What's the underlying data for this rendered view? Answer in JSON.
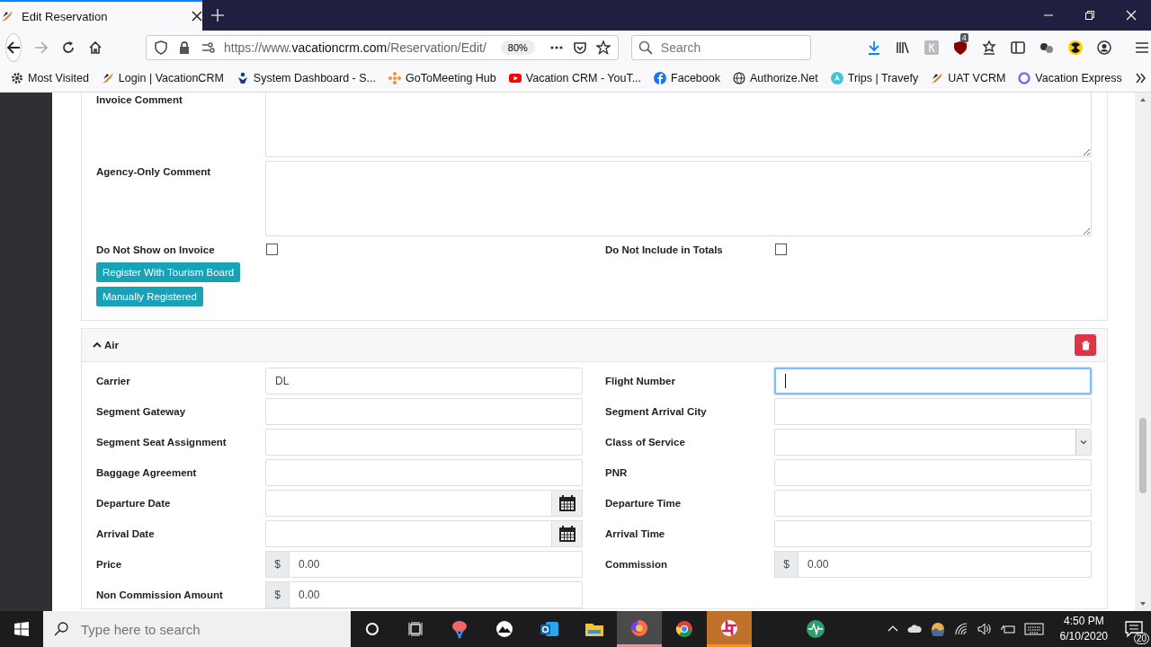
{
  "browser": {
    "tab": {
      "title": "Edit Reservation",
      "selected": true
    },
    "address": {
      "scheme": "https://www.",
      "domain": "vacationcrm.com",
      "path": "/Reservation/Edit/"
    },
    "zoom": "80%",
    "search": {
      "placeholder": "Search"
    },
    "extension_badge": "4",
    "bookmarks": [
      {
        "label": "Most Visited"
      },
      {
        "label": "Login | VacationCRM"
      },
      {
        "label": "System Dashboard - S..."
      },
      {
        "label": "GoToMeeting Hub"
      },
      {
        "label": "Vacation CRM - YouT..."
      },
      {
        "label": "Facebook"
      },
      {
        "label": "Authorize.Net"
      },
      {
        "label": "Trips | Travefy"
      },
      {
        "label": "UAT VCRM"
      },
      {
        "label": "Vacation Express"
      }
    ]
  },
  "page": {
    "comments": [
      {
        "label": "Invoice Comment"
      },
      {
        "label": "Agency-Only Comment"
      }
    ],
    "checkboxes": [
      {
        "label": "Do Not Show on Invoice",
        "checked": false
      },
      {
        "label": "Do Not Include in Totals",
        "checked": false
      }
    ],
    "buttons": [
      "Register With Tourism Board",
      "Manually Registered"
    ],
    "section": {
      "title": "Air",
      "expanded": true
    },
    "fields": [
      {
        "label": "Carrier",
        "kind": "text",
        "value": "DL",
        "focused": false
      },
      {
        "label": "Flight Number",
        "kind": "text",
        "focused": true
      },
      {
        "label": "Segment Gateway",
        "kind": "text",
        "focused": false
      },
      {
        "label": "Segment Arrival City",
        "kind": "text",
        "focused": false
      },
      {
        "label": "Segment Seat Assignment",
        "kind": "text",
        "focused": false
      },
      {
        "label": "Class of Service",
        "kind": "select",
        "focused": false
      },
      {
        "label": "Baggage Agreement",
        "kind": "text",
        "focused": false
      },
      {
        "label": "PNR",
        "kind": "text",
        "focused": false
      },
      {
        "label": "Departure Date",
        "kind": "date",
        "focused": false
      },
      {
        "label": "Departure Time",
        "kind": "text",
        "focused": false
      },
      {
        "label": "Arrival Date",
        "kind": "date",
        "focused": false
      },
      {
        "label": "Arrival Time",
        "kind": "text",
        "focused": false
      },
      {
        "label": "Price",
        "kind": "money",
        "currency": "$",
        "value": "0.00",
        "focused": false
      },
      {
        "label": "Commission",
        "kind": "money",
        "currency": "$",
        "value": "0.00",
        "focused": false
      },
      {
        "label": "Non Commission Amount",
        "kind": "money",
        "currency": "$",
        "value": "0.00",
        "focused": false
      }
    ]
  },
  "taskbar": {
    "search": {
      "placeholder": "Type here to search"
    },
    "apps": [
      {
        "selected": false,
        "flashing": false
      },
      {
        "selected": false,
        "flashing": false
      },
      {
        "selected": false,
        "flashing": false
      },
      {
        "selected": false,
        "flashing": false
      },
      {
        "selected": true,
        "flashing": false
      },
      {
        "selected": false,
        "flashing": false
      },
      {
        "selected": false,
        "flashing": true
      }
    ],
    "time": "4:50 PM",
    "date": "6/10/2020",
    "notifications": "20"
  }
}
